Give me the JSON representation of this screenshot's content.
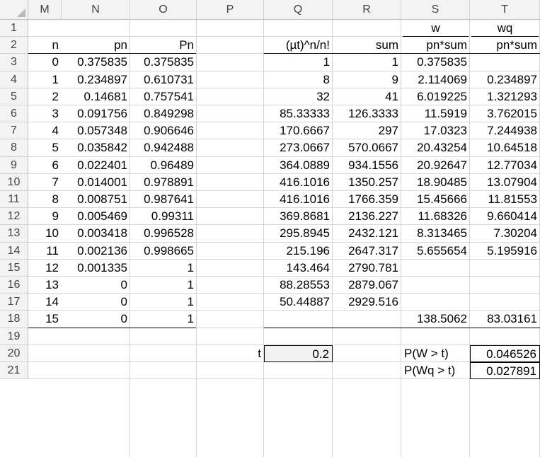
{
  "columns": [
    "M",
    "N",
    "O",
    "P",
    "Q",
    "R",
    "S",
    "T"
  ],
  "rows": [
    "1",
    "2",
    "3",
    "4",
    "5",
    "6",
    "7",
    "8",
    "9",
    "10",
    "11",
    "12",
    "13",
    "14",
    "15",
    "16",
    "17",
    "18",
    "19",
    "20",
    "21"
  ],
  "headers": {
    "S1": "w",
    "T1": "wq",
    "M2": "n",
    "N2": "pn",
    "O2": "Pn",
    "Q2": "(µt)^n/n!",
    "R2": "sum",
    "S2": "pn*sum",
    "T2": "pn*sum"
  },
  "table": [
    {
      "n": "0",
      "pn": "0.375835",
      "Pn": "0.375835",
      "q": "1",
      "sum": "1",
      "w": "0.375835",
      "wq": ""
    },
    {
      "n": "1",
      "pn": "0.234897",
      "Pn": "0.610731",
      "q": "8",
      "sum": "9",
      "w": "2.114069",
      "wq": "0.234897"
    },
    {
      "n": "2",
      "pn": "0.14681",
      "Pn": "0.757541",
      "q": "32",
      "sum": "41",
      "w": "6.019225",
      "wq": "1.321293"
    },
    {
      "n": "3",
      "pn": "0.091756",
      "Pn": "0.849298",
      "q": "85.33333",
      "sum": "126.3333",
      "w": "11.5919",
      "wq": "3.762015"
    },
    {
      "n": "4",
      "pn": "0.057348",
      "Pn": "0.906646",
      "q": "170.6667",
      "sum": "297",
      "w": "17.0323",
      "wq": "7.244938"
    },
    {
      "n": "5",
      "pn": "0.035842",
      "Pn": "0.942488",
      "q": "273.0667",
      "sum": "570.0667",
      "w": "20.43254",
      "wq": "10.64518"
    },
    {
      "n": "6",
      "pn": "0.022401",
      "Pn": "0.96489",
      "q": "364.0889",
      "sum": "934.1556",
      "w": "20.92647",
      "wq": "12.77034"
    },
    {
      "n": "7",
      "pn": "0.014001",
      "Pn": "0.978891",
      "q": "416.1016",
      "sum": "1350.257",
      "w": "18.90485",
      "wq": "13.07904"
    },
    {
      "n": "8",
      "pn": "0.008751",
      "Pn": "0.987641",
      "q": "416.1016",
      "sum": "1766.359",
      "w": "15.45666",
      "wq": "11.81553"
    },
    {
      "n": "9",
      "pn": "0.005469",
      "Pn": "0.99311",
      "q": "369.8681",
      "sum": "2136.227",
      "w": "11.68326",
      "wq": "9.660414"
    },
    {
      "n": "10",
      "pn": "0.003418",
      "Pn": "0.996528",
      "q": "295.8945",
      "sum": "2432.121",
      "w": "8.313465",
      "wq": "7.30204"
    },
    {
      "n": "11",
      "pn": "0.002136",
      "Pn": "0.998665",
      "q": "215.196",
      "sum": "2647.317",
      "w": "5.655654",
      "wq": "5.195916"
    },
    {
      "n": "12",
      "pn": "0.001335",
      "Pn": "1",
      "q": "143.464",
      "sum": "2790.781",
      "w": "",
      "wq": ""
    },
    {
      "n": "13",
      "pn": "0",
      "Pn": "1",
      "q": "88.28553",
      "sum": "2879.067",
      "w": "",
      "wq": ""
    },
    {
      "n": "14",
      "pn": "0",
      "Pn": "1",
      "q": "50.44887",
      "sum": "2929.516",
      "w": "",
      "wq": ""
    },
    {
      "n": "15",
      "pn": "0",
      "Pn": "1",
      "q": "",
      "sum": "",
      "w": "138.5062",
      "wq": "83.03161"
    }
  ],
  "inputs": {
    "t_label": "t",
    "t_value": "0.2",
    "pw_label": "P(W > t)",
    "pw_value": "0.046526",
    "pwq_label": "P(Wq > t)",
    "pwq_value": "0.027891"
  }
}
